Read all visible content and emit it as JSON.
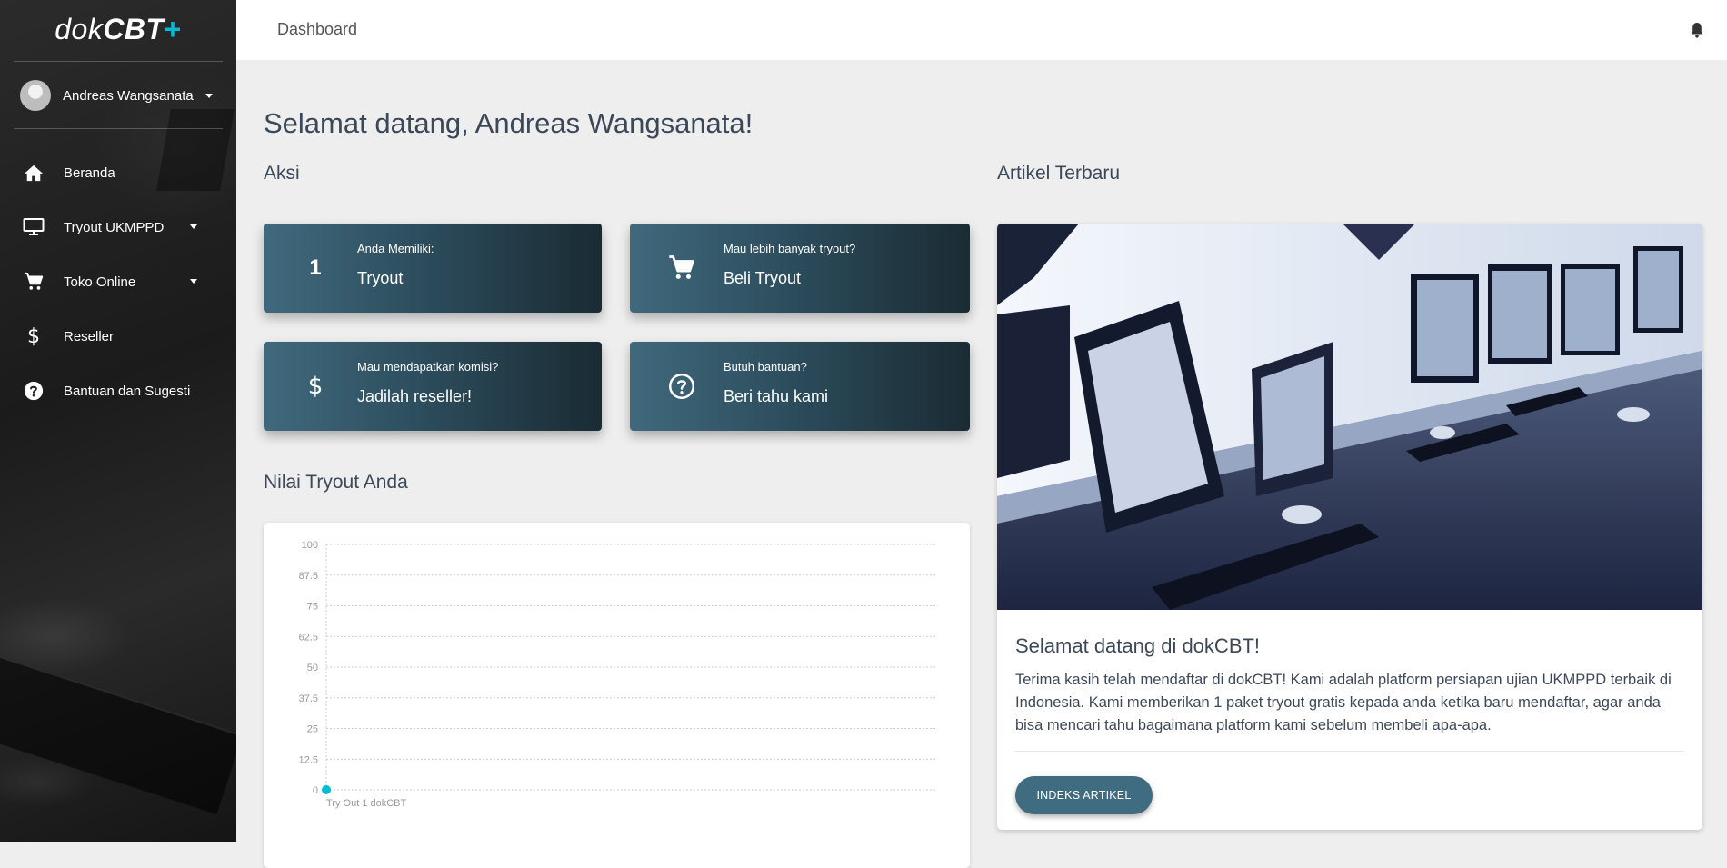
{
  "sidebar": {
    "logo": {
      "part1": "dok",
      "part2": "CBT",
      "part3": "+"
    },
    "user": {
      "name": "Andreas Wangsanata"
    },
    "items": [
      {
        "label": "Beranda",
        "icon": "home-icon"
      },
      {
        "label": "Tryout UKMPPD",
        "icon": "monitor-icon"
      },
      {
        "label": "Toko Online",
        "icon": "cart-icon"
      },
      {
        "label": "Reseller",
        "icon": "dollar-icon"
      },
      {
        "label": "Bantuan dan Sugesti",
        "icon": "help-icon"
      }
    ]
  },
  "header": {
    "title": "Dashboard",
    "icon": "bell-icon"
  },
  "main": {
    "welcome": "Selamat datang, Andreas Wangsanata!",
    "actions_title": "Aksi",
    "actions": [
      {
        "icon_text": "1",
        "subtitle": "Anda Memiliki:",
        "title": "Tryout"
      },
      {
        "icon": "cart-icon",
        "subtitle": "Mau lebih banyak tryout?",
        "title": "Beli Tryout"
      },
      {
        "icon": "dollar-icon",
        "subtitle": "Mau mendapatkan komisi?",
        "title": "Jadilah reseller!"
      },
      {
        "icon": "help-icon",
        "subtitle": "Butuh bantuan?",
        "title": "Beri tahu kami"
      }
    ],
    "chart_section_title": "Nilai Tryout Anda",
    "articles_title": "Artikel Terbaru",
    "article": {
      "title": "Selamat datang di dokCBT!",
      "body": "Terima kasih telah mendaftar di dokCBT! Kami adalah platform persiapan ujian UKMPPD terbaik di Indonesia. Kami memberikan 1 paket tryout gratis kepada anda ketika baru mendaftar, agar anda bisa mencari tahu bagaimana platform kami sebelum membeli apa-apa.",
      "button": "INDEKS ARTIKEL"
    }
  },
  "colors": {
    "accent": "#00bcd4",
    "card_start": "#40697d",
    "card_end": "#1a2b33",
    "button": "#3f6c80"
  },
  "chart_data": {
    "type": "line",
    "categories": [
      "Try Out 1 dokCBT"
    ],
    "series": [
      {
        "values": [
          0
        ],
        "color": "#00bcd4"
      }
    ],
    "yticks": [
      "100",
      "87.5",
      "75",
      "62.5",
      "50",
      "37.5",
      "25",
      "12.5",
      "0"
    ],
    "ylim": [
      0,
      100
    ],
    "grid": true
  }
}
